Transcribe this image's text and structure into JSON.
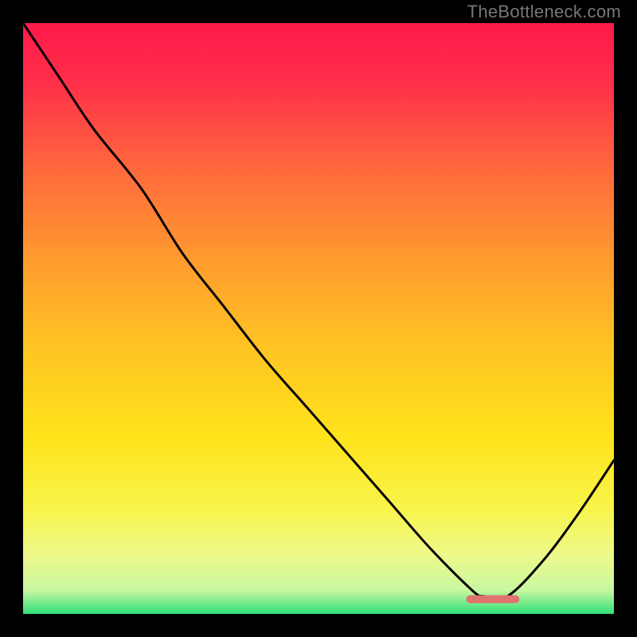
{
  "watermark": "TheBottleneck.com",
  "chart_data": {
    "type": "line",
    "title": "",
    "xlabel": "",
    "ylabel": "",
    "xlim": [
      0,
      100
    ],
    "ylim": [
      0,
      100
    ],
    "grid": false,
    "legend": false,
    "series": [
      {
        "name": "curve",
        "x": [
          0,
          6,
          12,
          20,
          27,
          34,
          41,
          48,
          55,
          62,
          69,
          76,
          78,
          82,
          88,
          94,
          100
        ],
        "values": [
          100,
          91,
          82,
          72,
          61,
          52,
          43,
          35,
          27,
          19,
          11,
          4,
          3,
          3,
          9,
          17,
          26
        ]
      }
    ],
    "optimum_marker": {
      "x_start": 75,
      "x_end": 84,
      "y": 2.5
    },
    "gradient_stops": [
      {
        "offset": 0,
        "color": "#ff1a4b"
      },
      {
        "offset": 0.1,
        "color": "#ff2e4a"
      },
      {
        "offset": 0.25,
        "color": "#ff6a3c"
      },
      {
        "offset": 0.4,
        "color": "#ff9a2e"
      },
      {
        "offset": 0.55,
        "color": "#ffc423"
      },
      {
        "offset": 0.7,
        "color": "#ffe31a"
      },
      {
        "offset": 0.82,
        "color": "#f8f44a"
      },
      {
        "offset": 0.9,
        "color": "#eef98a"
      },
      {
        "offset": 0.96,
        "color": "#c8f7a0"
      },
      {
        "offset": 1.0,
        "color": "#2fe07a"
      }
    ]
  }
}
